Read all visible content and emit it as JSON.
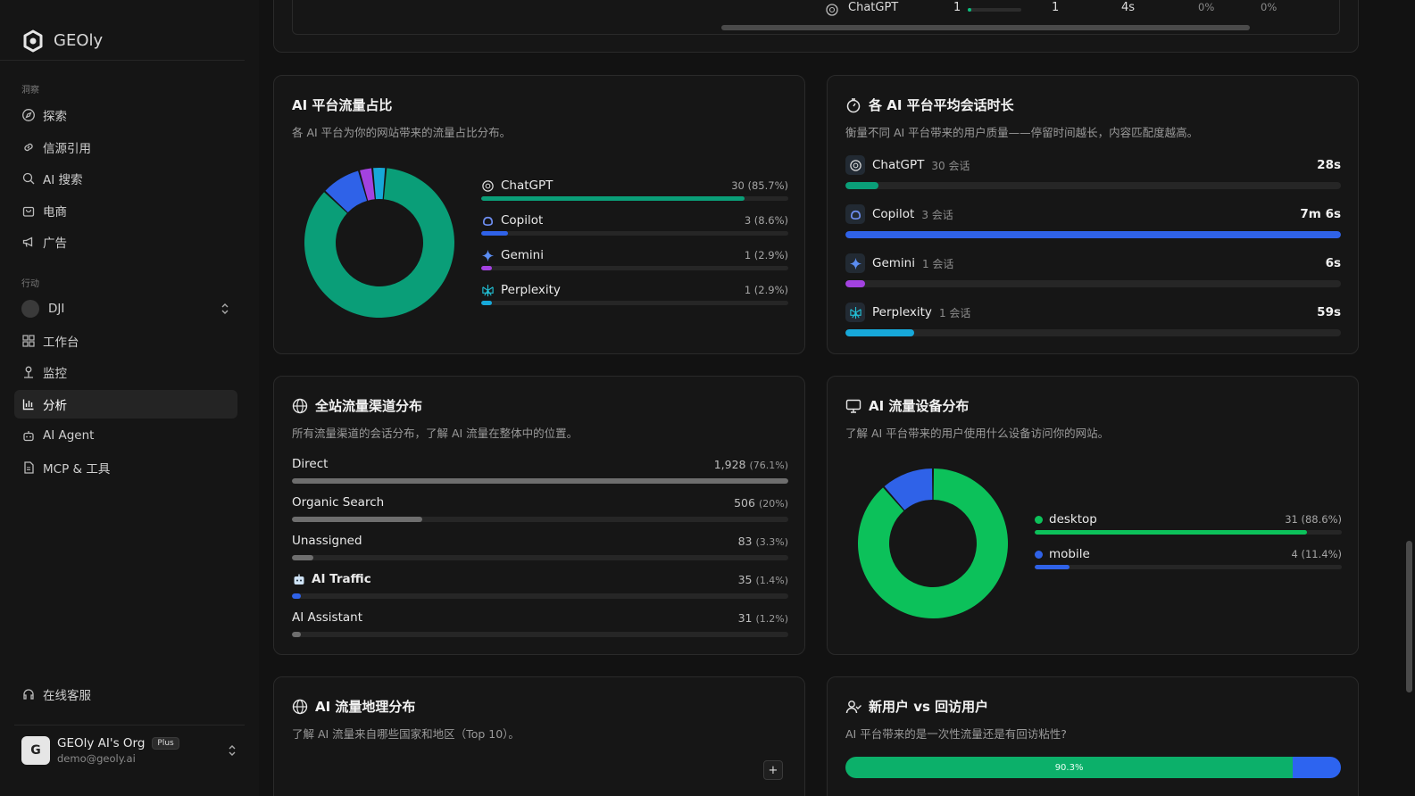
{
  "brand": {
    "name": "GEOly"
  },
  "sidebar": {
    "section_insights": "洞察",
    "insights": [
      {
        "label": "探索",
        "icon": "compass-icon"
      },
      {
        "label": "信源引用",
        "icon": "link-icon"
      },
      {
        "label": "AI 搜索",
        "icon": "search-icon"
      },
      {
        "label": "电商",
        "icon": "shopping-bag-icon"
      },
      {
        "label": "广告",
        "icon": "megaphone-icon"
      }
    ],
    "section_actions": "行动",
    "workspace": "DJI",
    "actions": [
      {
        "label": "工作台",
        "icon": "dashboard-icon"
      },
      {
        "label": "监控",
        "icon": "monitor-icon"
      },
      {
        "label": "分析",
        "icon": "bar-chart-icon",
        "active": true
      },
      {
        "label": "AI Agent",
        "icon": "robot-icon"
      },
      {
        "label": "MCP & 工具",
        "icon": "file-icon"
      }
    ],
    "support": "在线客服",
    "org": {
      "initial": "G",
      "name": "GEOly AI's Org",
      "plan": "Plus",
      "email": "demo@geoly.ai"
    }
  },
  "top_table_row": {
    "platform": "ChatGPT",
    "c1": "1",
    "c2": "1",
    "c3": "4s",
    "c4": "0%",
    "c5": "0%"
  },
  "platform_share": {
    "title": "AI 平台流量占比",
    "subtitle": "各 AI 平台为你的网站带来的流量占比分布。",
    "items": [
      {
        "name": "ChatGPT",
        "value": "30 (85.7%)",
        "fraction": 0.857,
        "color": "#0a9e78",
        "icon": "chatgpt-icon"
      },
      {
        "name": "Copilot",
        "value": "3 (8.6%)",
        "fraction": 0.086,
        "color": "#2f62e8",
        "icon": "copilot-icon"
      },
      {
        "name": "Gemini",
        "value": "1 (2.9%)",
        "fraction": 0.029,
        "color": "#a342e0",
        "icon": "gemini-icon"
      },
      {
        "name": "Perplexity",
        "value": "1 (2.9%)",
        "fraction": 0.029,
        "color": "#17a8d9",
        "icon": "perplexity-icon"
      }
    ]
  },
  "session_duration": {
    "title": "各 AI 平台平均会话时长",
    "subtitle": "衡量不同 AI 平台带来的用户质量——停留时间越长，内容匹配度越高。",
    "items": [
      {
        "name": "ChatGPT",
        "sessions": "30 会话",
        "duration": "28s",
        "fraction": 0.066,
        "color": "#0a9e78",
        "icon": "chatgpt-icon"
      },
      {
        "name": "Copilot",
        "sessions": "3 会话",
        "duration": "7m 6s",
        "fraction": 1.0,
        "color": "#2f62e8",
        "icon": "copilot-icon"
      },
      {
        "name": "Gemini",
        "sessions": "1 会话",
        "duration": "6s",
        "fraction": 0.04,
        "color": "#a342e0",
        "icon": "gemini-icon"
      },
      {
        "name": "Perplexity",
        "sessions": "1 会话",
        "duration": "59s",
        "fraction": 0.139,
        "color": "#17a8d9",
        "icon": "perplexity-icon"
      }
    ]
  },
  "channels": {
    "title": "全站流量渠道分布",
    "subtitle": "所有流量渠道的会话分布，了解 AI 流量在整体中的位置。",
    "items": [
      {
        "name": "Direct",
        "count": "1,928",
        "pct": "(76.1%)",
        "fraction": 1.0,
        "color": "#6e6e6e"
      },
      {
        "name": "Organic Search",
        "count": "506",
        "pct": "(20%)",
        "fraction": 0.263,
        "color": "#6e6e6e"
      },
      {
        "name": "Unassigned",
        "count": "83",
        "pct": "(3.3%)",
        "fraction": 0.043,
        "color": "#6e6e6e"
      },
      {
        "name": "AI Traffic",
        "count": "35",
        "pct": "(1.4%)",
        "fraction": 0.018,
        "color": "#2f62e8",
        "icon": "robot-icon"
      },
      {
        "name": "AI Assistant",
        "count": "31",
        "pct": "(1.2%)",
        "fraction": 0.016,
        "color": "#6e6e6e"
      }
    ]
  },
  "devices": {
    "title": "AI 流量设备分布",
    "subtitle": "了解 AI 平台带来的用户使用什么设备访问你的网站。",
    "items": [
      {
        "name": "desktop",
        "value": "31 (88.6%)",
        "fraction": 0.886,
        "color": "#0cc15a"
      },
      {
        "name": "mobile",
        "value": "4 (11.4%)",
        "fraction": 0.114,
        "color": "#2f62e8"
      }
    ]
  },
  "geo": {
    "title": "AI 流量地理分布",
    "subtitle": "了解 AI 流量来自哪些国家和地区（Top 10）。",
    "zoom_in": "+"
  },
  "new_vs_returning": {
    "title": "新用户 vs 回访用户",
    "subtitle": "AI 平台带来的是一次性流量还是有回访粘性?",
    "new_fraction": 0.903,
    "new_label": "90.3%"
  }
}
